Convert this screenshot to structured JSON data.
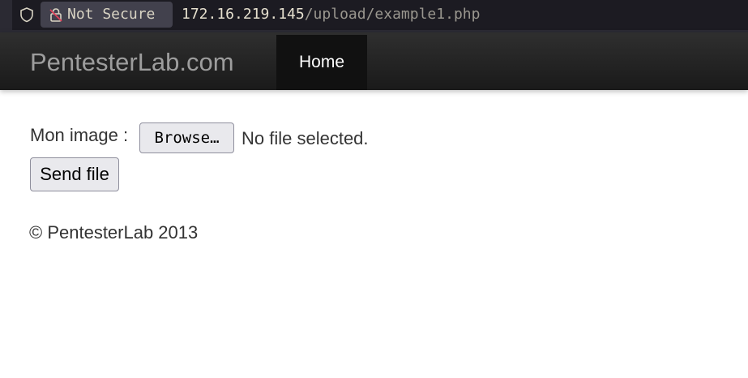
{
  "browser": {
    "security_label": "Not Secure",
    "url_host": "172.16.219.145",
    "url_path": "/upload/example1.php",
    "icons": {
      "shield": "shield-icon",
      "lock": "lock-slash-icon"
    }
  },
  "navbar": {
    "brand": "PentesterLab.com",
    "items": [
      {
        "label": "Home",
        "active": true
      }
    ]
  },
  "form": {
    "image_label": "Mon image :",
    "browse_label": "Browse…",
    "file_status": "No file selected.",
    "submit_label": "Send file"
  },
  "footer": {
    "text": "© PentesterLab 2013"
  },
  "colors": {
    "navbar_bg": "#222222",
    "nav_active_bg": "#111111",
    "brand_text": "#9d9d9d",
    "body_text": "#333333"
  }
}
